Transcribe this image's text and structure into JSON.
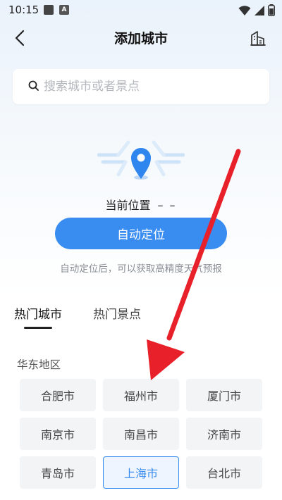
{
  "status_bar": {
    "time": "10:15",
    "badge": "A"
  },
  "header": {
    "title": "添加城市"
  },
  "search": {
    "placeholder": "搜索城市或者景点"
  },
  "location": {
    "current_label": "当前位置",
    "current_value": "– –",
    "auto_button_label": "自动定位",
    "hint": "自动定位后，可以获取高精度天气预报"
  },
  "tabs": [
    {
      "label": "热门城市",
      "active": true
    },
    {
      "label": "热门景点",
      "active": false
    }
  ],
  "region": {
    "label": "华东地区"
  },
  "cities": [
    "合肥市",
    "福州市",
    "厦门市",
    "南京市",
    "南昌市",
    "济南市",
    "青岛市",
    "上海市",
    "台北市"
  ],
  "selected_city": "上海市",
  "colors": {
    "accent": "#3a8df0",
    "arrow": "#e8202a"
  }
}
